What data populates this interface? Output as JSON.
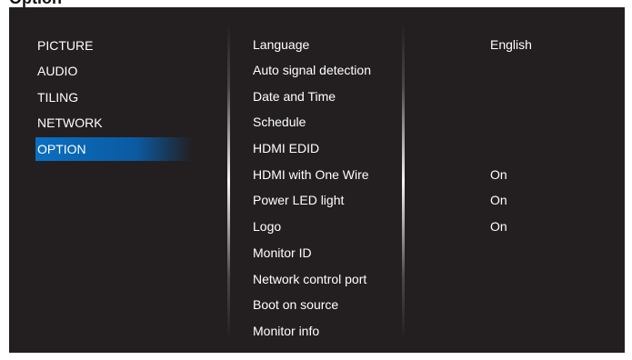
{
  "header": {
    "cut_title": "Option"
  },
  "main_menu": {
    "items": [
      {
        "label": "PICTURE",
        "selected": false
      },
      {
        "label": "AUDIO",
        "selected": false
      },
      {
        "label": "TILING",
        "selected": false
      },
      {
        "label": "NETWORK",
        "selected": false
      },
      {
        "label": "OPTION",
        "selected": true
      }
    ],
    "highlight_color": "#0a6fc2"
  },
  "submenu": {
    "items": [
      {
        "label": "Language",
        "value": "English"
      },
      {
        "label": "Auto signal detection",
        "value": ""
      },
      {
        "label": "Date and Time",
        "value": ""
      },
      {
        "label": "Schedule",
        "value": ""
      },
      {
        "label": "HDMI EDID",
        "value": ""
      },
      {
        "label": "HDMI with One Wire",
        "value": "On"
      },
      {
        "label": "Power LED light",
        "value": "On"
      },
      {
        "label": "Logo",
        "value": "On"
      },
      {
        "label": "Monitor ID",
        "value": ""
      },
      {
        "label": "Network control port",
        "value": ""
      },
      {
        "label": "Boot on source",
        "value": ""
      },
      {
        "label": "Monitor info",
        "value": ""
      }
    ]
  },
  "colors": {
    "osd_background": "#231f20",
    "text": "#ffffff"
  }
}
